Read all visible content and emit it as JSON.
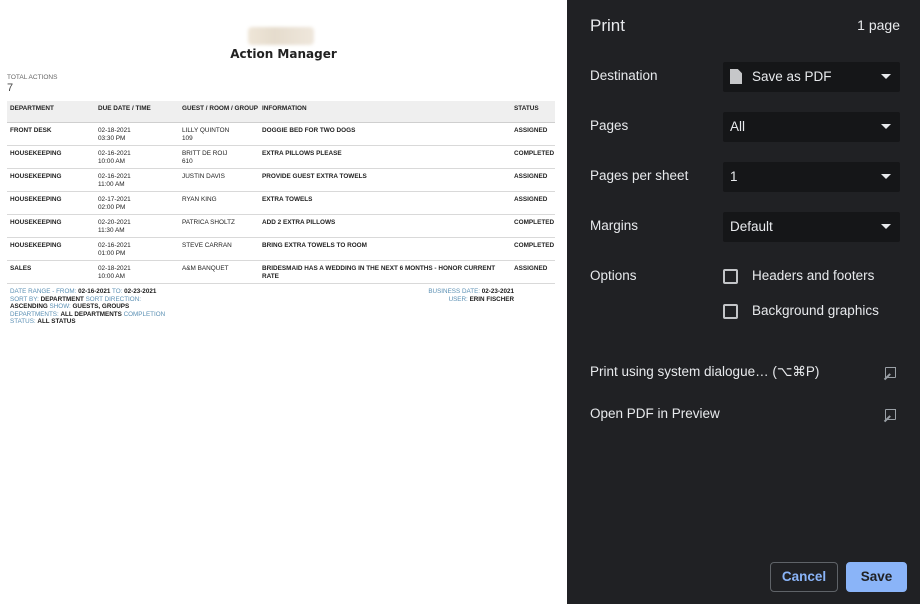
{
  "preview": {
    "title": "Action Manager",
    "total_label": "TOTAL ACTIONS",
    "total_value": "7",
    "columns": [
      "DEPARTMENT",
      "DUE DATE / TIME",
      "GUEST / ROOM / GROUP",
      "INFORMATION",
      "STATUS"
    ],
    "rows": [
      {
        "dept": "FRONT DESK",
        "date": "02-18-2021",
        "time": "03:30 PM",
        "guest": "LILLY QUINTON",
        "room": "109",
        "info": "DOGGIE BED FOR TWO DOGS",
        "status": "ASSIGNED"
      },
      {
        "dept": "HOUSEKEEPING",
        "date": "02-16-2021",
        "time": "10:00 AM",
        "guest": "BRITT DE ROIJ",
        "room": "610",
        "info": "EXTRA PILLOWS PLEASE",
        "status": "COMPLETED"
      },
      {
        "dept": "HOUSEKEEPING",
        "date": "02-16-2021",
        "time": "11:00 AM",
        "guest": "JUSTIN DAVIS",
        "room": "",
        "info": "PROVIDE GUEST EXTRA TOWELS",
        "status": "ASSIGNED"
      },
      {
        "dept": "HOUSEKEEPING",
        "date": "02-17-2021",
        "time": "02:00 PM",
        "guest": "RYAN KING",
        "room": "",
        "info": "EXTRA TOWELS",
        "status": "ASSIGNED"
      },
      {
        "dept": "HOUSEKEEPING",
        "date": "02-20-2021",
        "time": "11:30 AM",
        "guest": "PATRICA SHOLTZ",
        "room": "",
        "info": "ADD 2 EXTRA PILLOWS",
        "status": "COMPLETED"
      },
      {
        "dept": "HOUSEKEEPING",
        "date": "02-16-2021",
        "time": "01:00 PM",
        "guest": "STEVE CARRAN",
        "room": "",
        "info": "BRING EXTRA TOWELS TO ROOM",
        "status": "COMPLETED"
      },
      {
        "dept": "SALES",
        "date": "02-18-2021",
        "time": "10:00 AM",
        "guest": "A&M BANQUET",
        "room": "",
        "info": "BRIDESMAID HAS A WEDDING IN THE NEXT 6 MONTHS - HONOR CURRENT RATE",
        "status": "ASSIGNED"
      }
    ],
    "footer": {
      "date_range_label": "DATE RANGE - FROM:",
      "date_from": "02-16-2021",
      "to_label": "TO:",
      "date_to": "02-23-2021",
      "sort_by_label": "SORT BY:",
      "sort_by": "DEPARTMENT",
      "sort_dir_label": "SORT DIRECTION:",
      "sort_dir": "ASCENDING",
      "show_label": "SHOW:",
      "show": "GUESTS, GROUPS",
      "departments_label": "DEPARTMENTS:",
      "departments": "ALL DEPARTMENTS",
      "completion_label": "COMPLETION STATUS:",
      "completion": "ALL STATUS",
      "business_date_label": "BUSINESS DATE:",
      "business_date": "02-23-2021",
      "user_label": "USER:",
      "user": "ERIN FISCHER"
    }
  },
  "dialog": {
    "title": "Print",
    "page_count": "1 page",
    "destination_label": "Destination",
    "destination_value": "Save as PDF",
    "destination_icon": "document-icon",
    "pages_label": "Pages",
    "pages_value": "All",
    "pages_per_sheet_label": "Pages per sheet",
    "pages_per_sheet_value": "1",
    "margins_label": "Margins",
    "margins_value": "Default",
    "options_label": "Options",
    "option_headers": "Headers and footers",
    "option_background": "Background graphics",
    "system_dialog_link": "Print using system dialogue… (⌥⌘P)",
    "open_pdf_link": "Open PDF in Preview",
    "cancel_label": "Cancel",
    "save_label": "Save",
    "accent_color": "#8ab4f8",
    "background_color": "#202124"
  }
}
